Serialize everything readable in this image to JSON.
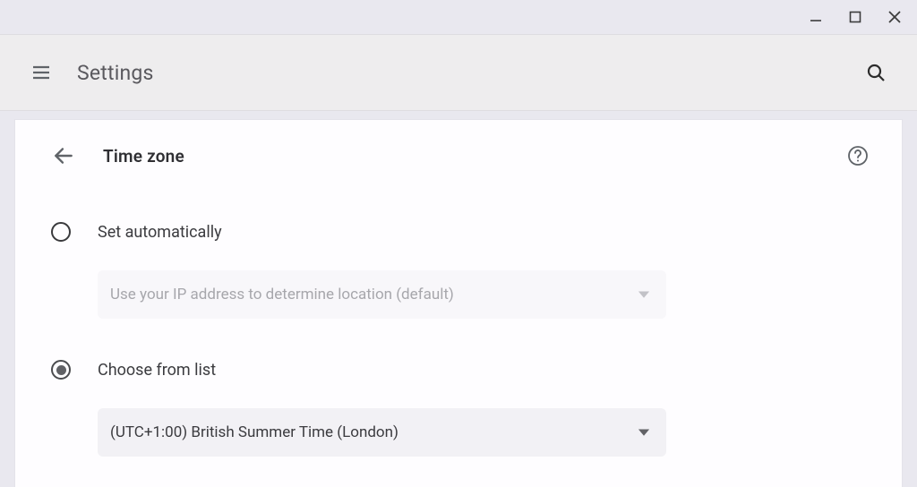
{
  "header": {
    "app_title": "Settings"
  },
  "page": {
    "title": "Time zone"
  },
  "options": [
    {
      "label": "Set automatically",
      "selected": false,
      "dropdown": {
        "text": "Use your IP address to determine location (default)",
        "enabled": false
      }
    },
    {
      "label": "Choose from list",
      "selected": true,
      "dropdown": {
        "text": "(UTC+1:00) British Summer Time (London)",
        "enabled": true
      }
    }
  ]
}
